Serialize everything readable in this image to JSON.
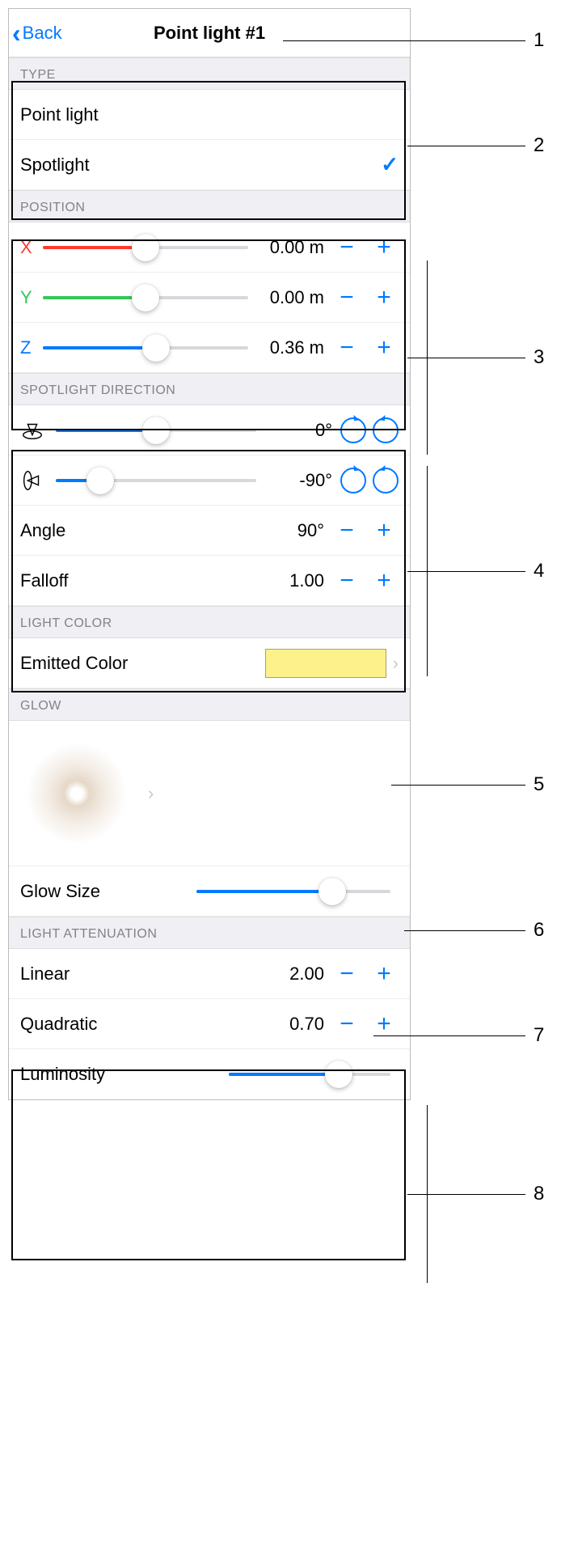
{
  "nav": {
    "back": "Back",
    "title": "Point light #1"
  },
  "type": {
    "header": "TYPE",
    "opt1": "Point light",
    "opt2": "Spotlight"
  },
  "position": {
    "header": "POSITION",
    "x": {
      "label": "X",
      "value": "0.00 m",
      "fill": 50,
      "color": "#ff3b30"
    },
    "y": {
      "label": "Y",
      "value": "0.00 m",
      "fill": 50,
      "color": "#34c759"
    },
    "z": {
      "label": "Z",
      "value": "0.36 m",
      "fill": 55,
      "color": "#007aff"
    }
  },
  "spotdir": {
    "header": "SPOTLIGHT DIRECTION",
    "azimuth": {
      "value": "0°",
      "fill": 50
    },
    "elevation": {
      "value": "-90°",
      "fill": 22
    },
    "angle": {
      "label": "Angle",
      "value": "90°"
    },
    "falloff": {
      "label": "Falloff",
      "value": "1.00"
    }
  },
  "lightcolor": {
    "header": "LIGHT COLOR",
    "emitted": {
      "label": "Emitted Color",
      "color": "#fcf18a"
    }
  },
  "glow": {
    "header": "GLOW",
    "size": {
      "label": "Glow Size",
      "fill": 70
    }
  },
  "atten": {
    "header": "LIGHT ATTENUATION",
    "linear": {
      "label": "Linear",
      "value": "2.00"
    },
    "quadratic": {
      "label": "Quadratic",
      "value": "0.70"
    },
    "luminosity": {
      "label": "Luminosity",
      "fill": 68
    }
  },
  "callouts": {
    "1": "1",
    "2": "2",
    "3": "3",
    "4": "4",
    "5": "5",
    "6": "6",
    "7": "7",
    "8": "8"
  }
}
